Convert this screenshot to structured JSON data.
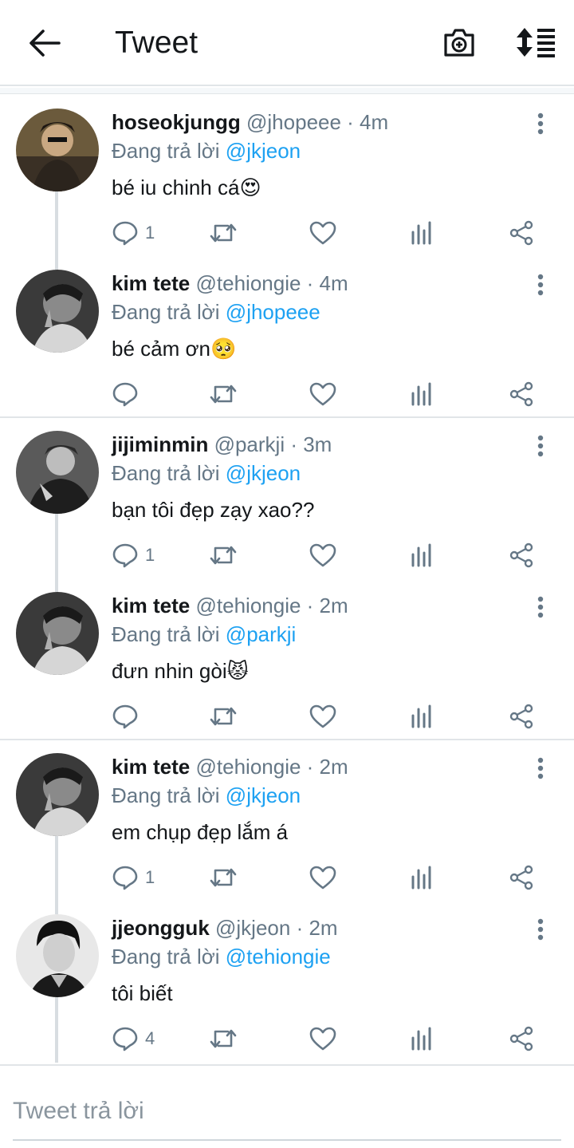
{
  "header": {
    "title": "Tweet",
    "back_icon": "arrow-left-icon",
    "camera_icon": "camera-plus-icon",
    "sort_icon": "sort-list-icon"
  },
  "colors": {
    "accent": "#1da1f2",
    "secondary_text": "#657786",
    "divider": "#e1e5e8",
    "thread_line": "#d8dde1"
  },
  "tweets": [
    {
      "name": "hoseokjungg",
      "handle": "@jhopeee · 4m",
      "replying_to": "Đang trả lời",
      "mention": "@jkjeon",
      "text": "bé iu chinh cá😍",
      "reply_count": "1",
      "avatar": "dark-portrait"
    },
    {
      "name": "kim tete",
      "handle": "@tehiongie · 4m",
      "replying_to": "Đang trả lời",
      "mention": "@jhopeee",
      "text": "bé cảm ơn🥺",
      "reply_count": "",
      "avatar": "grey-portrait"
    },
    {
      "name": "jijiminmin",
      "handle": "@parkji · 3m",
      "replying_to": "Đang trả lời",
      "mention": "@jkjeon",
      "text": "bạn tôi đẹp zạy xao??",
      "reply_count": "1",
      "avatar": "grey-portrait"
    },
    {
      "name": "kim tete",
      "handle": "@tehiongie · 2m",
      "replying_to": "Đang trả lời",
      "mention": "@parkji",
      "text": "đưn nhin gòi😾",
      "reply_count": "",
      "avatar": "grey-portrait"
    },
    {
      "name": "kim tete",
      "handle": "@tehiongie · 2m",
      "replying_to": "Đang trả lời",
      "mention": "@jkjeon",
      "text": "em chụp đẹp lắm á",
      "reply_count": "1",
      "avatar": "grey-portrait"
    },
    {
      "name": "jjeongguk",
      "handle": "@jkjeon · 2m",
      "replying_to": "Đang trả lời",
      "mention": "@tehiongie",
      "text": "tôi biết",
      "reply_count": "4",
      "avatar": "bw-portrait"
    }
  ],
  "reply_box": {
    "placeholder": "Tweet trả lời"
  }
}
